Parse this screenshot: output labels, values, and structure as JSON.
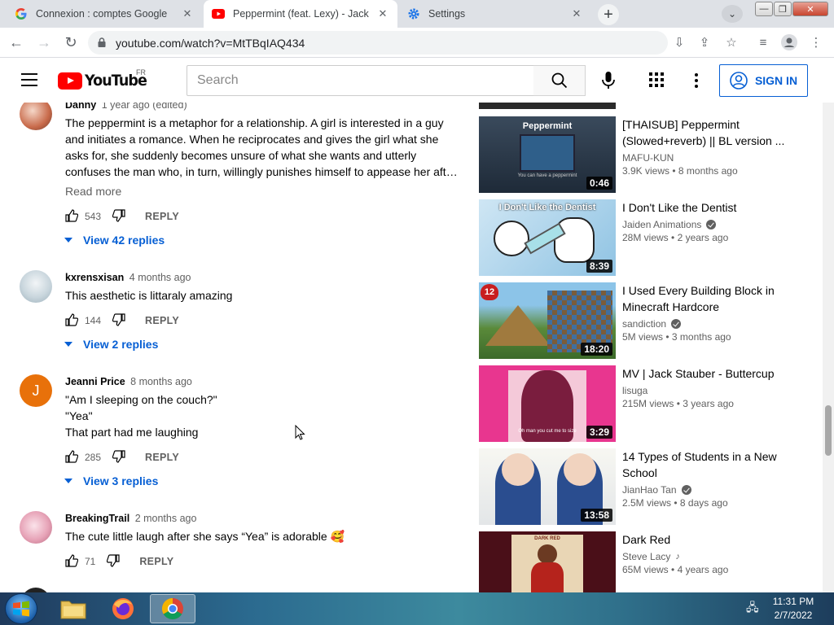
{
  "browser": {
    "tabs": [
      {
        "label": "Connexion : comptes Google",
        "icon": "google-icon",
        "active": false
      },
      {
        "label": "Peppermint (feat. Lexy) - Jack Sta",
        "icon": "youtube-icon",
        "active": true
      },
      {
        "label": "Settings",
        "icon": "settings-gear-icon",
        "active": false
      }
    ],
    "url": "youtube.com/watch?v=MtTBqIAQ434"
  },
  "header": {
    "logo_text": "YouTube",
    "country": "FR",
    "search_placeholder": "Search",
    "signin_label": "SIGN IN"
  },
  "comments": [
    {
      "author": "Danny",
      "time": "1 year ago (edited)",
      "lines": [
        "The peppermint is a metaphor for a relationship. A girl is interested in a guy",
        "and initiates a romance. When he reciprocates and gives the girl what she",
        "asks for, she suddenly becomes unsure of what she wants and utterly",
        "confuses the man who, in turn, willingly punishes himself to appease her afte…"
      ],
      "read_more": "Read more",
      "likes": "543",
      "reply_label": "REPLY",
      "view_replies": "View 42 replies"
    },
    {
      "author": "kxrensxisan",
      "time": "4 months ago",
      "lines": [
        "This aesthetic is littaraly amazing"
      ],
      "likes": "144",
      "reply_label": "REPLY",
      "view_replies": "View 2 replies"
    },
    {
      "author": "Jeanni Price",
      "time": "8 months ago",
      "avatar_letter": "J",
      "lines": [
        "\"Am I sleeping on the couch?\"",
        "\"Yea\"",
        "That part had me laughing"
      ],
      "likes": "285",
      "reply_label": "REPLY",
      "view_replies": "View 3 replies"
    },
    {
      "author": "BreakingTrail",
      "time": "2 months ago",
      "lines": [
        "The cute little laugh after she says “Yea” is adorable 🥰"
      ],
      "likes": "71",
      "reply_label": "REPLY"
    }
  ],
  "recommendations": [
    {
      "title_lines": [
        "[THAISUB] Peppermint",
        "(Slowed+reverb) || BL version ..."
      ],
      "channel": "MAFU-KUN",
      "verified": false,
      "views": "3.9K views",
      "age": "8 months ago",
      "duration": "0:46",
      "thumb_text": "Peppermint",
      "thumb_caption": "You can have a peppermint"
    },
    {
      "title_lines": [
        "I Don't Like the Dentist"
      ],
      "channel": "Jaiden Animations",
      "verified": true,
      "views": "28M views",
      "age": "2 years ago",
      "duration": "8:39",
      "thumb_text": "I Don't Like the Dentist"
    },
    {
      "title_lines": [
        "I Used Every Building Block in",
        "Minecraft Hardcore"
      ],
      "channel": "sandiction",
      "verified": true,
      "views": "5M views",
      "age": "3 months ago",
      "duration": "18:20",
      "thumb_badge": "12"
    },
    {
      "title_lines": [
        "MV | Jack Stauber - Buttercup"
      ],
      "channel": "lisuga",
      "verified": false,
      "views": "215M views",
      "age": "3 years ago",
      "duration": "3:29",
      "thumb_caption": "Oh man you cut me to size"
    },
    {
      "title_lines": [
        "14 Types of Students in a New",
        "School"
      ],
      "channel": "JianHao Tan",
      "verified": true,
      "views": "2.5M views",
      "age": "8 days ago",
      "duration": "13:58"
    },
    {
      "title_lines": [
        "Dark Red"
      ],
      "channel": "Steve Lacy",
      "verified": false,
      "music": true,
      "views": "65M views",
      "age": "4 years ago",
      "thumb_text": "DARK RED"
    }
  ],
  "taskbar": {
    "time": "11:31 PM",
    "date": "2/7/2022"
  },
  "colors": {
    "yt_red": "#ff0000",
    "link_blue": "#065fd4",
    "tab_strip": "#dee1e6"
  }
}
